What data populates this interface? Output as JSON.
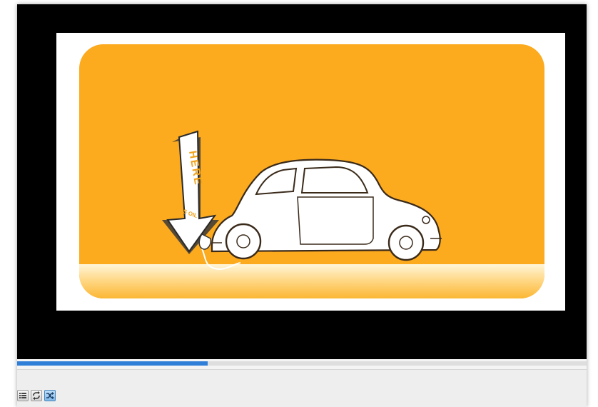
{
  "player": {
    "progress_fraction": 0.335,
    "accent_color": "#2f7ed8"
  },
  "slide": {
    "background_color": "#fcaa1e",
    "sign": {
      "main_text": "HERE",
      "sub_text": "S OIL"
    }
  },
  "controls": {
    "buttons": [
      {
        "icon": "playlist-icon",
        "active": false
      },
      {
        "icon": "repeat-icon",
        "active": false
      },
      {
        "icon": "shuffle-icon",
        "active": true
      }
    ]
  }
}
